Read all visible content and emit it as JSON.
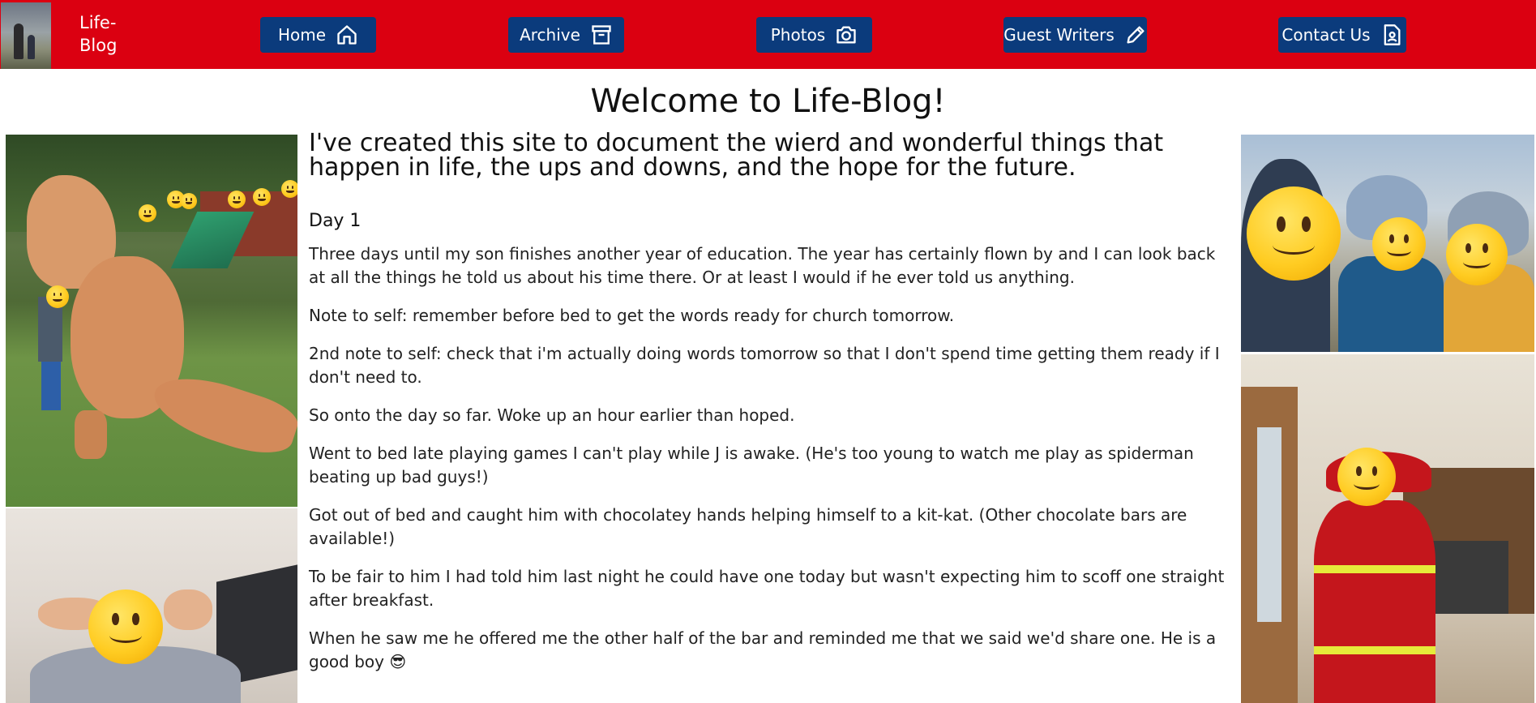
{
  "nav": {
    "brand": "Life-\nBlog",
    "items": [
      {
        "label": "Home",
        "icon": "home-icon"
      },
      {
        "label": "Archive",
        "icon": "archive-icon"
      },
      {
        "label": "Photos",
        "icon": "camera-icon"
      },
      {
        "label": "Guest Writers",
        "icon": "pencil-icon"
      },
      {
        "label": "Contact Us",
        "icon": "contact-document-icon"
      }
    ],
    "colors": {
      "bar": "#db0011",
      "button": "#0b3b7c",
      "text": "#ffffff"
    }
  },
  "page": {
    "title": "Welcome to Life-Blog!",
    "intro": "I've created this site to document the wierd and wonderful things that happen in life, the ups and downs, and the hope for the future.",
    "day_heading": "Day 1",
    "paragraphs": [
      "Three days until my son finishes another year of education. The year has certainly flown by and I can look back at all the things he told us about his time there. Or at least I would if he ever told us anything.",
      "Note to self: remember before bed to get the words ready for church tomorrow.",
      "2nd note to self: check that i'm actually doing words tomorrow so that I don't spend time getting them ready if I don't need to.",
      "So onto the day so far. Woke up an hour earlier than hoped.",
      "Went to bed late playing games I can't play while J is awake. (He's too young to watch me play as spiderman beating up bad guys!)",
      "Got out of bed and caught him with chocolatey hands helping himself to a kit-kat. (Other chocolate bars are available!)",
      "To be fair to him I had told him last night he could have one today but wasn't expecting him to scoff one straight after breakfast.",
      "When he saw me he offered me the other half of the bar and reminded me that we said we'd share one. He is a good boy 😎"
    ]
  }
}
